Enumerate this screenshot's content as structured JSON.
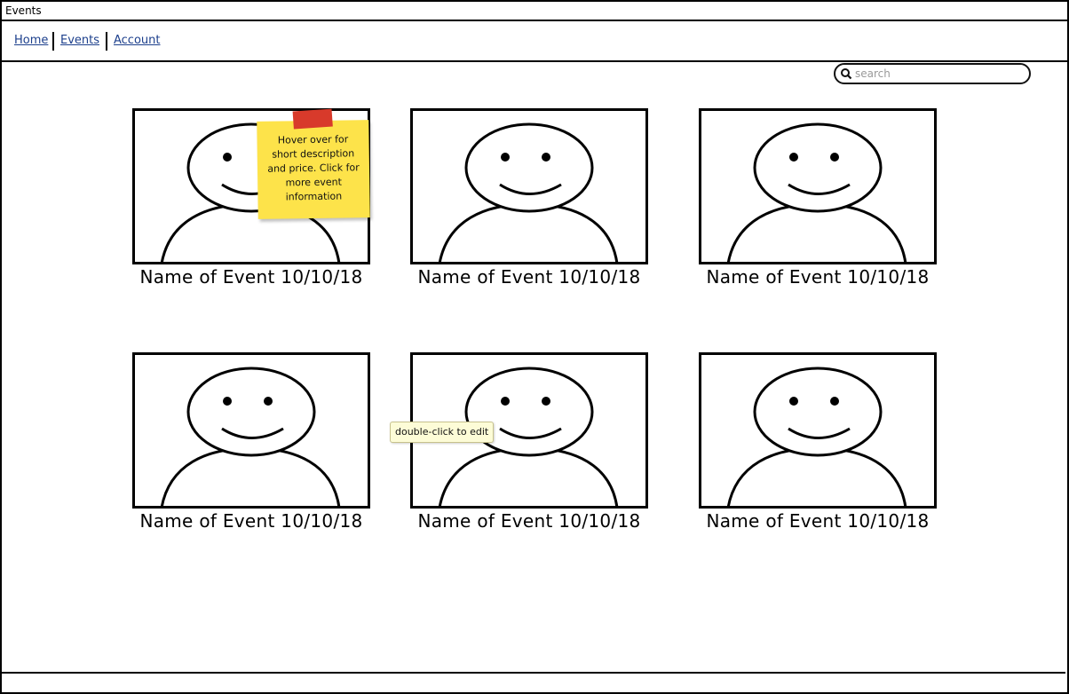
{
  "window": {
    "title": "Events"
  },
  "nav": {
    "items": [
      {
        "label": "Home"
      },
      {
        "label": "Events"
      },
      {
        "label": "Account"
      }
    ]
  },
  "search": {
    "placeholder": "search",
    "value": ""
  },
  "events": [
    {
      "label": "Name of Event 10/10/18"
    },
    {
      "label": "Name of Event 10/10/18"
    },
    {
      "label": "Name of Event 10/10/18"
    },
    {
      "label": "Name of Event 10/10/18"
    },
    {
      "label": "Name of Event 10/10/18"
    },
    {
      "label": "Name of Event 10/10/18"
    }
  ],
  "sticky_note": {
    "text": "Hover over for short description and price. Click for more event information"
  },
  "tooltip": {
    "text": "double-click to edit"
  },
  "colors": {
    "link": "#1c3f8c",
    "sticky": "#fde34a",
    "tape": "#d83a2b",
    "tooltip_bg": "#fdfcd7"
  }
}
